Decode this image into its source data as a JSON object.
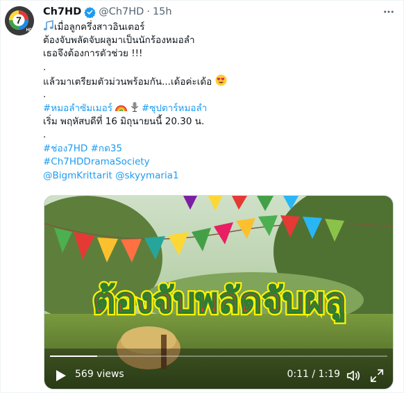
{
  "author": {
    "name": "Ch7HD",
    "handle": "@Ch7HD",
    "separator": "·",
    "time": "15h",
    "avatar_text": "7",
    "avatar_subtext": "HD"
  },
  "tweet": {
    "line1": "เมื่อลูกครึ่งสาวอินเตอร์",
    "line2": "ต้องจับพลัดจับผลูมาเป็นนักร้องหมอลำ",
    "line3": "เธอจึงต้องการตัวช่วย !!!",
    "line4": ".",
    "line5": "แล้วมาเตรียมตัวม่วนพร้อมกัน...เด้อค่ะเด้อ",
    "line6": ".",
    "hashtag1": "#หมอลำซัมเมอร์",
    "hashtag2": "#ซุปตาร์หมอลำ",
    "line8": "เริ่ม พฤหัสบดีที่ 16 มิถุนายนนี้ 20.30 น.",
    "line9": ".",
    "hashtag3": "#ช่อง7HD",
    "hashtag4": "#กด35",
    "hashtag5": "#Ch7HDDramaSociety",
    "mention1": "@BigmKrittarit",
    "mention2": "@skyymaria1"
  },
  "media": {
    "title_overlay": "ต้องจับพลัดจับผลู",
    "views": "569 views",
    "time_code": "0:11 / 1:19",
    "progress": 0.14
  },
  "icons": {
    "more": "more-horizontal-icon",
    "verified": "verified-badge-icon",
    "music": "musical-notes-emoji",
    "heart_eyes": "heart-eyes-emoji",
    "rainbow": "rainbow-emoji",
    "microphone": "microphone-emoji",
    "play": "play-icon",
    "volume": "volume-icon",
    "fullscreen": "fullscreen-icon"
  },
  "colors": {
    "link": "#1d9bf0",
    "verified": "#1d9bf0",
    "secondary_text": "#536471"
  }
}
